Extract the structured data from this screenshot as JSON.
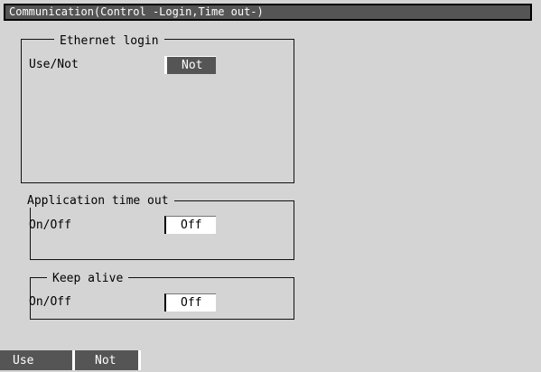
{
  "title": "Communication(Control -Login,Time out-)",
  "ethernet_login": {
    "legend": "Ethernet login",
    "use_not_label": "Use/Not",
    "use_not_value": "Not"
  },
  "app_timeout": {
    "legend": "Application time out",
    "onoff_label": "On/Off",
    "onoff_value": "Off"
  },
  "keep_alive": {
    "legend": "Keep alive",
    "onoff_label": "On/Off",
    "onoff_value": "Off"
  },
  "softkeys": {
    "use": "Use",
    "not": "Not"
  }
}
